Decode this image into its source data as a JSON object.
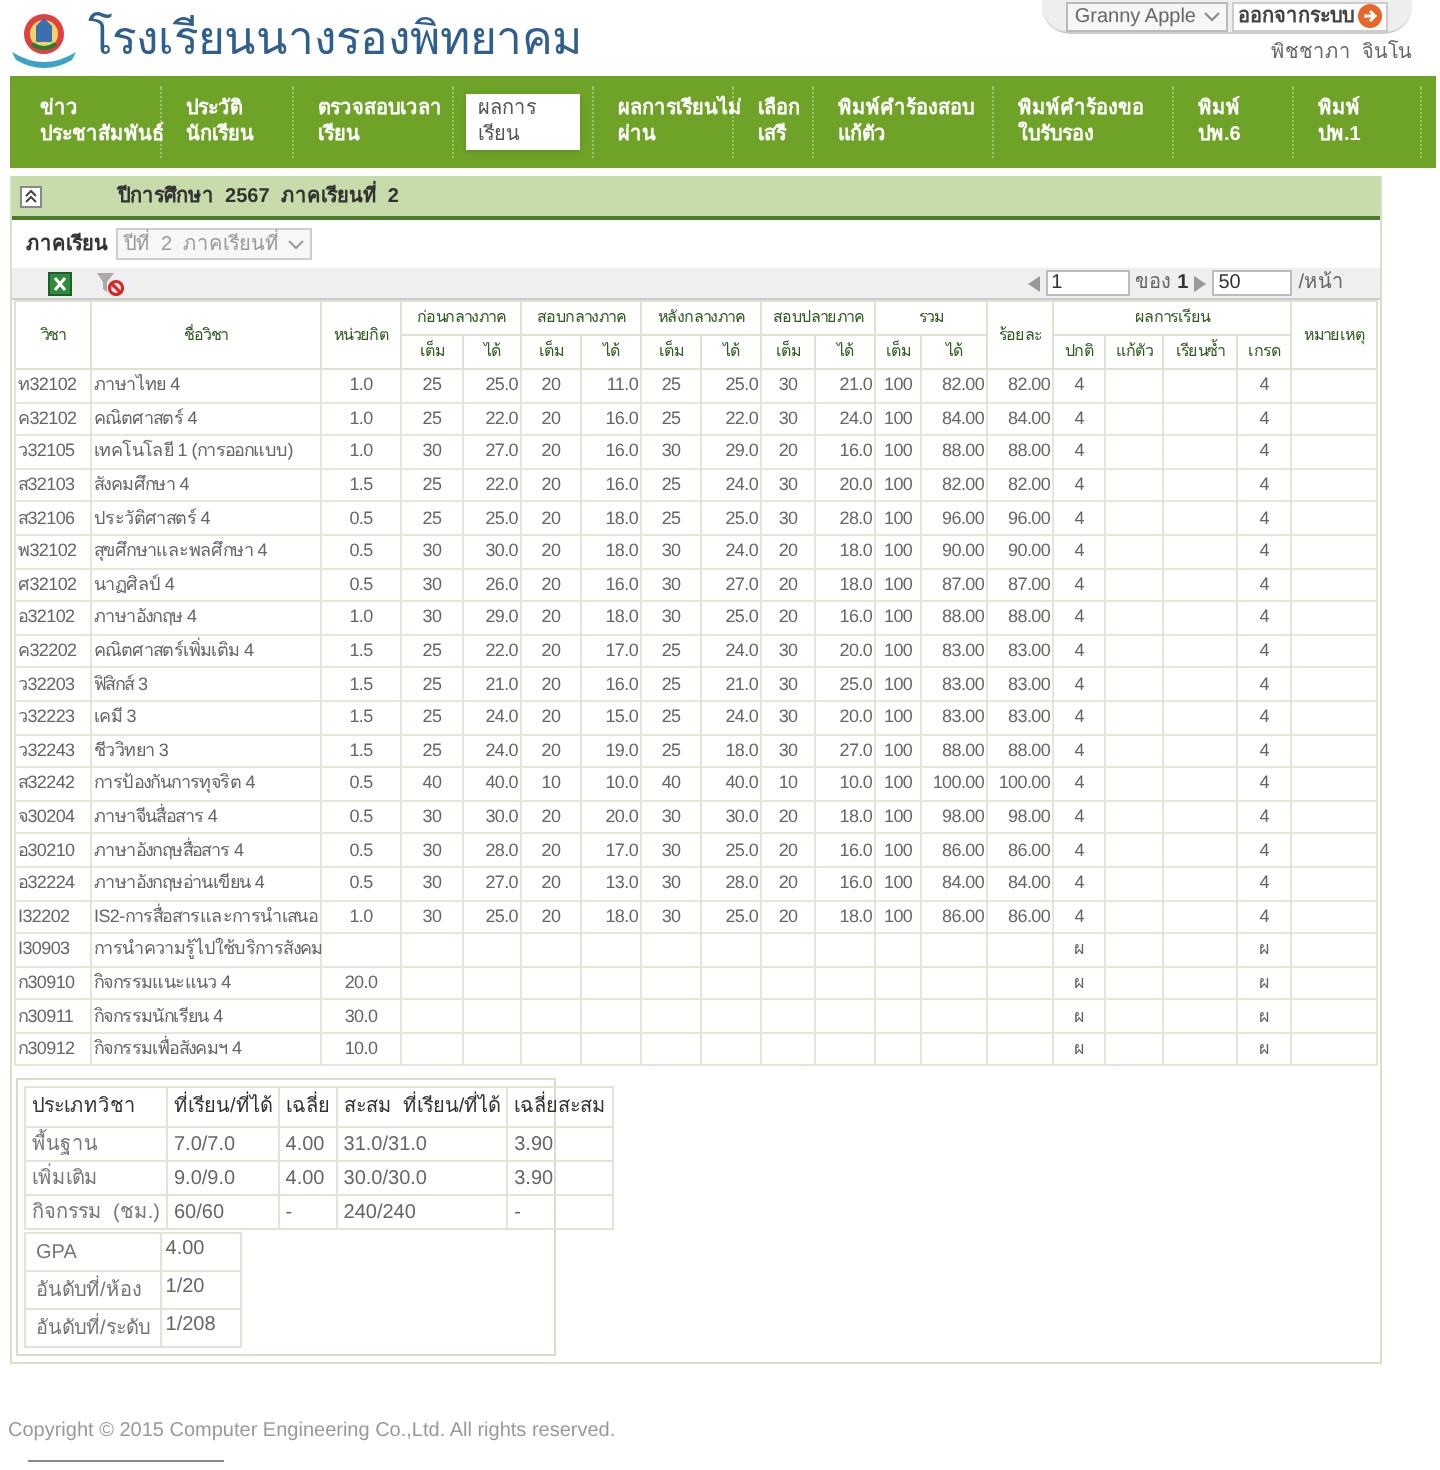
{
  "header": {
    "school_name": "โรงเรียนนางรองพิทยาคม",
    "account": "Granny Apple",
    "logout": "ออกจากระบบ",
    "user_name": "พิชชาภา  จินโน"
  },
  "nav": [
    {
      "lines": [
        "ข่าว",
        "ประชาสัมพันธ์"
      ],
      "selected": false
    },
    {
      "lines": [
        "ประวัติ",
        "นักเรียน"
      ],
      "selected": false
    },
    {
      "lines": [
        "ตรวจสอบเวลา",
        "เรียน"
      ],
      "selected": false
    },
    {
      "lines": [
        "ผลการ",
        "เรียน"
      ],
      "selected": true
    },
    {
      "lines": [
        "ผลการเรียนไม่",
        "ผ่าน"
      ],
      "selected": false
    },
    {
      "lines": [
        "เลือก",
        "เสรี"
      ],
      "selected": false
    },
    {
      "lines": [
        "พิมพ์คำร้องสอบ",
        "แก้ตัว"
      ],
      "selected": false
    },
    {
      "lines": [
        "พิมพ์คำร้องขอ",
        "ใบรับรอง"
      ],
      "selected": false
    },
    {
      "lines": [
        "พิมพ์",
        "ปพ.6"
      ],
      "selected": false
    },
    {
      "lines": [
        "พิมพ์",
        "ปพ.1"
      ],
      "selected": false
    }
  ],
  "panel": {
    "title": "ปีการศึกษา  2567  ภาคเรียนที่  2",
    "filter_label": "ภาคเรียน",
    "filter_value": "ปีที่  2  ภาคเรียนที่"
  },
  "pager": {
    "page": "1",
    "of_label": "ของ",
    "pages": "1",
    "per_page": "50",
    "per_page_label": "/หน้า"
  },
  "table": {
    "columns": [
      {
        "label": "วิชา"
      },
      {
        "label": "ชื่อวิชา"
      },
      {
        "label": "หน่วยกิต"
      },
      {
        "label": "ก่อนกลางภาค",
        "sub": [
          "เต็ม",
          "ได้"
        ]
      },
      {
        "label": "สอบกลางภาค",
        "sub": [
          "เต็ม",
          "ได้"
        ]
      },
      {
        "label": "หลังกลางภาค",
        "sub": [
          "เต็ม",
          "ได้"
        ]
      },
      {
        "label": "สอบปลายภาค",
        "sub": [
          "เต็ม",
          "ได้"
        ]
      },
      {
        "label": "รวม",
        "sub": [
          "เต็ม",
          "ได้"
        ]
      },
      {
        "label": "ร้อยละ"
      },
      {
        "label": "ผลการเรียน",
        "sub": [
          "ปกติ",
          "แก้ตัว",
          "เรียนซ้ำ",
          "เกรด"
        ]
      },
      {
        "label": "หมายเหตุ"
      }
    ],
    "rows": [
      {
        "code": "ท32102",
        "name": "ภาษาไทย  4",
        "credits": "1.0",
        "scores": [
          "25",
          "25.0",
          "20",
          "11.0",
          "25",
          "25.0",
          "30",
          "21.0",
          "100",
          "82.00"
        ],
        "percent": "82.00",
        "normal": "4",
        "grade": "4"
      },
      {
        "code": "ค32102",
        "name": "คณิตศาสตร์  4",
        "credits": "1.0",
        "scores": [
          "25",
          "22.0",
          "20",
          "16.0",
          "25",
          "22.0",
          "30",
          "24.0",
          "100",
          "84.00"
        ],
        "percent": "84.00",
        "normal": "4",
        "grade": "4"
      },
      {
        "code": "ว32105",
        "name": "เทคโนโลยี  1  (การออกแบบ)",
        "credits": "1.0",
        "scores": [
          "30",
          "27.0",
          "20",
          "16.0",
          "30",
          "29.0",
          "20",
          "16.0",
          "100",
          "88.00"
        ],
        "percent": "88.00",
        "normal": "4",
        "grade": "4"
      },
      {
        "code": "ส32103",
        "name": "สังคมศึกษา  4",
        "credits": "1.5",
        "scores": [
          "25",
          "22.0",
          "20",
          "16.0",
          "25",
          "24.0",
          "30",
          "20.0",
          "100",
          "82.00"
        ],
        "percent": "82.00",
        "normal": "4",
        "grade": "4"
      },
      {
        "code": "ส32106",
        "name": "ประวัติศาสตร์  4",
        "credits": "0.5",
        "scores": [
          "25",
          "25.0",
          "20",
          "18.0",
          "25",
          "25.0",
          "30",
          "28.0",
          "100",
          "96.00"
        ],
        "percent": "96.00",
        "normal": "4",
        "grade": "4"
      },
      {
        "code": "พ32102",
        "name": "สุขศึกษาและพลศึกษา  4",
        "credits": "0.5",
        "scores": [
          "30",
          "30.0",
          "20",
          "18.0",
          "30",
          "24.0",
          "20",
          "18.0",
          "100",
          "90.00"
        ],
        "percent": "90.00",
        "normal": "4",
        "grade": "4"
      },
      {
        "code": "ศ32102",
        "name": "นาฏศิลป์  4",
        "credits": "0.5",
        "scores": [
          "30",
          "26.0",
          "20",
          "16.0",
          "30",
          "27.0",
          "20",
          "18.0",
          "100",
          "87.00"
        ],
        "percent": "87.00",
        "normal": "4",
        "grade": "4"
      },
      {
        "code": "อ32102",
        "name": "ภาษาอังกฤษ  4",
        "credits": "1.0",
        "scores": [
          "30",
          "29.0",
          "20",
          "18.0",
          "30",
          "25.0",
          "20",
          "16.0",
          "100",
          "88.00"
        ],
        "percent": "88.00",
        "normal": "4",
        "grade": "4"
      },
      {
        "code": "ค32202",
        "name": "คณิตศาสตร์เพิ่มเติม  4",
        "credits": "1.5",
        "scores": [
          "25",
          "22.0",
          "20",
          "17.0",
          "25",
          "24.0",
          "30",
          "20.0",
          "100",
          "83.00"
        ],
        "percent": "83.00",
        "normal": "4",
        "grade": "4"
      },
      {
        "code": "ว32203",
        "name": "ฟิสิกส์  3",
        "credits": "1.5",
        "scores": [
          "25",
          "21.0",
          "20",
          "16.0",
          "25",
          "21.0",
          "30",
          "25.0",
          "100",
          "83.00"
        ],
        "percent": "83.00",
        "normal": "4",
        "grade": "4"
      },
      {
        "code": "ว32223",
        "name": "เคมี  3",
        "credits": "1.5",
        "scores": [
          "25",
          "24.0",
          "20",
          "15.0",
          "25",
          "24.0",
          "30",
          "20.0",
          "100",
          "83.00"
        ],
        "percent": "83.00",
        "normal": "4",
        "grade": "4"
      },
      {
        "code": "ว32243",
        "name": "ชีววิทยา  3",
        "credits": "1.5",
        "scores": [
          "25",
          "24.0",
          "20",
          "19.0",
          "25",
          "18.0",
          "30",
          "27.0",
          "100",
          "88.00"
        ],
        "percent": "88.00",
        "normal": "4",
        "grade": "4"
      },
      {
        "code": "ส32242",
        "name": "การป้องกันการทุจริต  4",
        "credits": "0.5",
        "scores": [
          "40",
          "40.0",
          "10",
          "10.0",
          "40",
          "40.0",
          "10",
          "10.0",
          "100",
          "100.00"
        ],
        "percent": "100.00",
        "normal": "4",
        "grade": "4"
      },
      {
        "code": "จ30204",
        "name": "ภาษาจีนสื่อสาร  4",
        "credits": "0.5",
        "scores": [
          "30",
          "30.0",
          "20",
          "20.0",
          "30",
          "30.0",
          "20",
          "18.0",
          "100",
          "98.00"
        ],
        "percent": "98.00",
        "normal": "4",
        "grade": "4"
      },
      {
        "code": "อ30210",
        "name": "ภาษาอังกฤษสื่อสาร  4",
        "credits": "0.5",
        "scores": [
          "30",
          "28.0",
          "20",
          "17.0",
          "30",
          "25.0",
          "20",
          "16.0",
          "100",
          "86.00"
        ],
        "percent": "86.00",
        "normal": "4",
        "grade": "4"
      },
      {
        "code": "อ32224",
        "name": "ภาษาอังกฤษอ่านเขียน  4",
        "credits": "0.5",
        "scores": [
          "30",
          "27.0",
          "20",
          "13.0",
          "30",
          "28.0",
          "20",
          "16.0",
          "100",
          "84.00"
        ],
        "percent": "84.00",
        "normal": "4",
        "grade": "4"
      },
      {
        "code": "I32202",
        "name": "IS2-การสื่อสารและการนำเสนอ",
        "credits": "1.0",
        "scores": [
          "30",
          "25.0",
          "20",
          "18.0",
          "30",
          "25.0",
          "20",
          "18.0",
          "100",
          "86.00"
        ],
        "percent": "86.00",
        "normal": "4",
        "grade": "4"
      },
      {
        "code": "I30903",
        "name": "การนำความรู้ไปใช้บริการสังคม",
        "normal": "ผ",
        "grade": "ผ"
      },
      {
        "code": "ก30910",
        "name": "กิจกรรมแนะแนว  4",
        "credits": "20.0",
        "normal": "ผ",
        "grade": "ผ"
      },
      {
        "code": "ก30911",
        "name": "กิจกรรมนักเรียน  4",
        "credits": "30.0",
        "normal": "ผ",
        "grade": "ผ"
      },
      {
        "code": "ก30912",
        "name": "กิจกรรมเพื่อสังคมฯ  4",
        "credits": "10.0",
        "normal": "ผ",
        "grade": "ผ"
      }
    ]
  },
  "summary": {
    "columns": [
      "ประเภทวิชา",
      "ที่เรียน/ที่ได้",
      "เฉลี่ย",
      "สะสม  ที่เรียน/ที่ได้",
      "เฉลี่ยสะสม"
    ],
    "rows": [
      [
        "พื้นฐาน",
        "7.0/7.0",
        "4.00",
        "31.0/31.0",
        "3.90"
      ],
      [
        "เพิ่มเติม",
        "9.0/9.0",
        "4.00",
        "30.0/30.0",
        "3.90"
      ],
      [
        "กิจกรรม  (ชม.)",
        "60/60",
        "-",
        "240/240",
        "-"
      ]
    ],
    "gpa": [
      {
        "label": "GPA",
        "value": "4.00"
      },
      {
        "label": "อันดับที่/ห้อง",
        "value": "1/20"
      },
      {
        "label": "อันดับที่/ระดับ",
        "value": "1/208"
      }
    ]
  },
  "footer": "Copyright © 2015 Computer Engineering Co.,Ltd. All rights reserved."
}
